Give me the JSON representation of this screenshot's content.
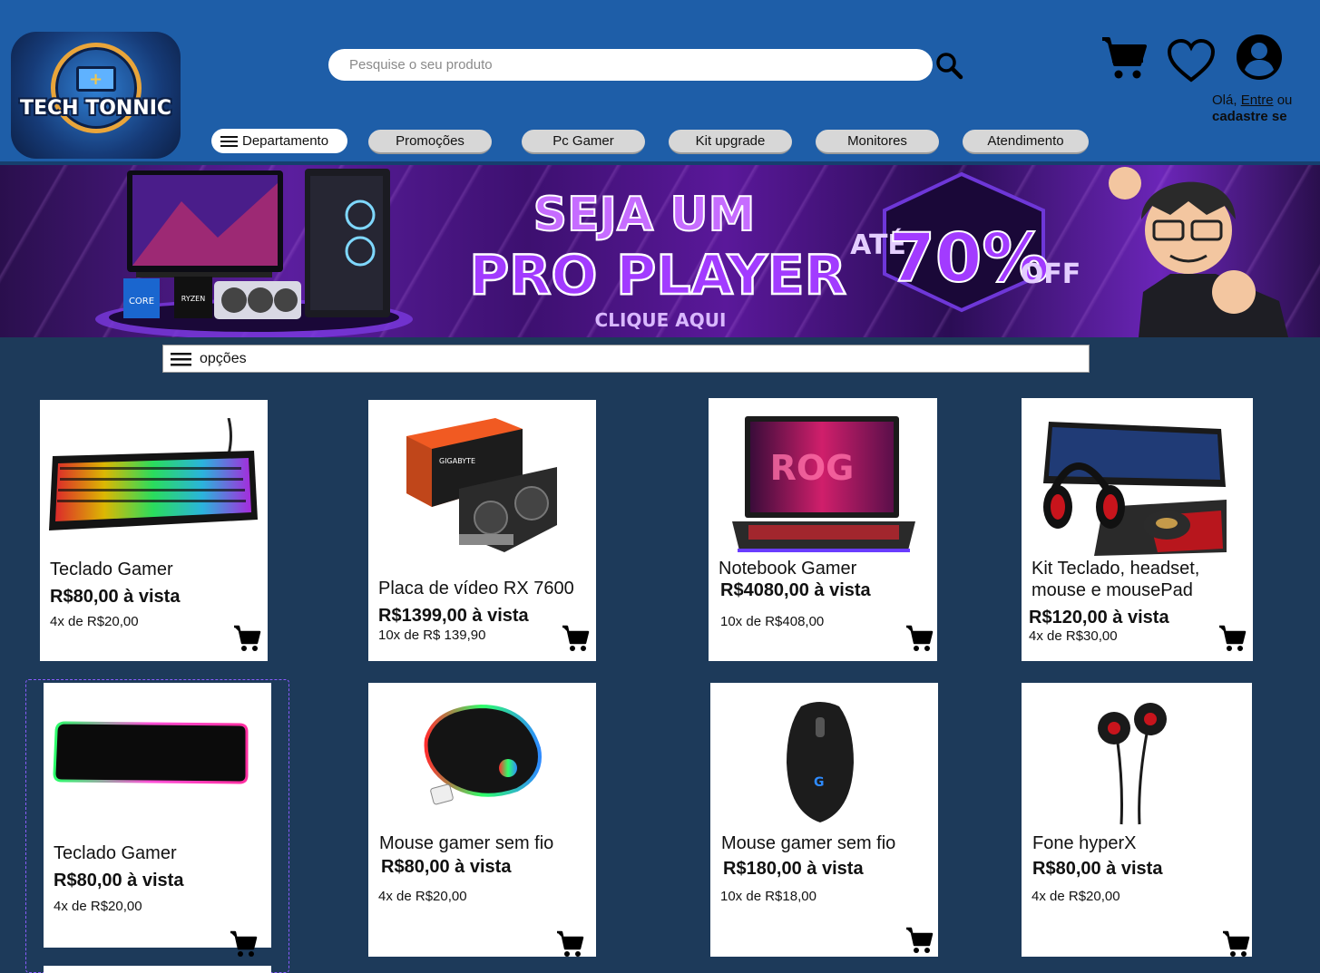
{
  "logo": {
    "brand": "TECH TONNIC",
    "icon": "techtonic-logo"
  },
  "search": {
    "placeholder": "Pesquise o seu produto",
    "icon": "search-icon"
  },
  "header_icons": {
    "cart": "cart-icon",
    "wishlist": "heart-icon",
    "account": "user-icon"
  },
  "greeting": {
    "hello": "Olá, ",
    "login": "Entre",
    "or": " ou",
    "signup": "cadastre se"
  },
  "nav": {
    "department": "Departamento",
    "items": [
      "Promoções",
      "Pc Gamer",
      "Kit upgrade",
      "Monitores",
      "Atendimento"
    ]
  },
  "banner": {
    "line1": "SEJA UM",
    "line2": "PRO PLAYER",
    "cta": "CLIQUE AQUI",
    "discount_prefix": "ATÉ",
    "discount": "70%",
    "discount_suffix": "OFF",
    "cpu_brand_1": "CORE",
    "cpu_brand_2": "RYZEN",
    "colors": {
      "accent": "#a23bff",
      "dark": "#2a0f4d"
    }
  },
  "options": {
    "label": "opções"
  },
  "products": [
    {
      "name": "Teclado Gamer",
      "price": "R$80,00 à vista",
      "installments": "4x de R$20,00",
      "image": "rgb-keyboard"
    },
    {
      "name": "Placa de vídeo RX 7600",
      "price": "R$1399,00 à vista",
      "installments": "10x de R$ 139,90",
      "image": "graphics-card",
      "box_brand": "GIGABYTE"
    },
    {
      "name": "Notebook Gamer",
      "price": "R$4080,00 à vista",
      "installments": "10x de R$408,00",
      "image": "gaming-laptop",
      "screen_text": "ROG"
    },
    {
      "name": "Kit Teclado, headset, mouse e mousePad",
      "price": "R$120,00 à vista",
      "installments": "4x de R$30,00",
      "image": "gamer-kit"
    },
    {
      "name": "Teclado Gamer",
      "price": "R$80,00 à vista",
      "installments": "4x de R$20,00",
      "image": "rgb-mousepad"
    },
    {
      "name": "Mouse gamer sem fio",
      "price": "R$80,00 à vista",
      "installments": "4x de R$20,00",
      "image": "wireless-mouse"
    },
    {
      "name": "Mouse gamer sem fio",
      "price": "R$180,00 à vista",
      "installments": "10x de R$18,00",
      "image": "logitech-mouse"
    },
    {
      "name": "Fone hyperX",
      "price": "R$80,00 à vista",
      "installments": "4x de R$20,00",
      "image": "earphones"
    }
  ]
}
